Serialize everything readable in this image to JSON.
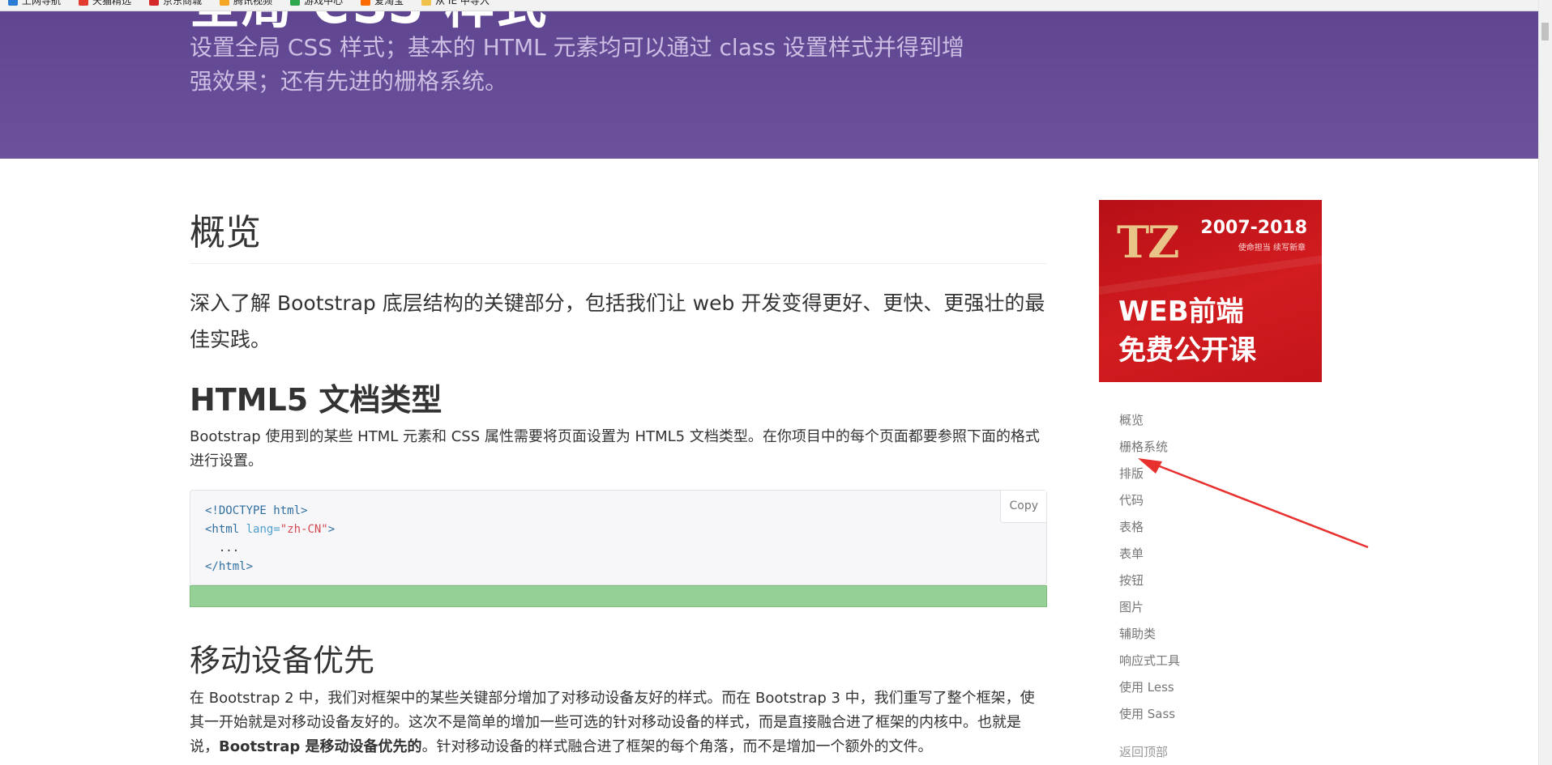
{
  "bookmarks": [
    {
      "label": "上网导航",
      "color": "#2a7bd6"
    },
    {
      "label": "天猫精选",
      "color": "#e33b2e"
    },
    {
      "label": "京东商城",
      "color": "#d62a2a"
    },
    {
      "label": "腾讯视频",
      "color": "#f5a623"
    },
    {
      "label": "游戏中心",
      "color": "#2fa84f"
    },
    {
      "label": "爱淘宝",
      "color": "#ff6a00"
    },
    {
      "label": "从 IE 中导入",
      "color": "#f0c14b"
    }
  ],
  "hero": {
    "title": "全局 CSS 样式",
    "lead": "设置全局 CSS 样式；基本的 HTML 元素均可以通过 class 设置样式并得到增强效果；还有先进的栅格系统。"
  },
  "overview": {
    "heading": "概览",
    "lead": "深入了解 Bootstrap 底层结构的关键部分，包括我们让 web 开发变得更好、更快、更强壮的最佳实践。"
  },
  "html5": {
    "heading": "HTML5 文档类型",
    "text": "Bootstrap 使用到的某些 HTML 元素和 CSS 属性需要将页面设置为 HTML5 文档类型。在你项目中的每个页面都要参照下面的格式进行设置。",
    "code": {
      "line1": "<!DOCTYPE html>",
      "line2_tag_open": "<html",
      "line2_attr": " lang=",
      "line2_value": "\"zh-CN\"",
      "line2_tag_close": ">",
      "line3": "  ...",
      "line4": "</html>"
    },
    "copy_label": "Copy"
  },
  "mobile": {
    "heading": "移动设备优先",
    "text_part1": "在 Bootstrap 2 中，我们对框架中的某些关键部分增加了对移动设备友好的样式。而在 Bootstrap 3 中，我们重写了整个框架，使其一开始就是对移动设备友好的。这次不是简单的增加一些可选的针对移动设备的样式，而是直接融合进了框架的内核中。也就是说，",
    "text_bold": "Bootstrap 是移动设备优先的",
    "text_part2": "。针对移动设备的样式融合进了框架的每个角落，而不是增加一个额外的文件。"
  },
  "ad": {
    "logo": "TZ",
    "years": "2007-2018",
    "slogan": "使命担当 续写新章",
    "line1": "WEB前端",
    "line2": "免费公开课"
  },
  "sidebar": {
    "items": [
      "概览",
      "栅格系统",
      "排版",
      "代码",
      "表格",
      "表单",
      "按钮",
      "图片",
      "辅助类",
      "响应式工具",
      "使用 Less",
      "使用 Sass"
    ],
    "back_to_top": "返回顶部"
  },
  "colors": {
    "hero_bg": "#6c519b",
    "annotation_arrow": "#e8312f",
    "success_bar": "#95d096"
  }
}
